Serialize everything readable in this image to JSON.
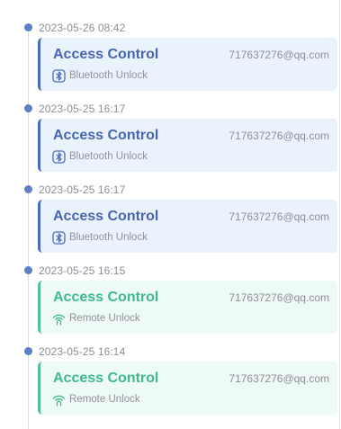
{
  "entries": [
    {
      "time": "2023-05-26 08:42",
      "title": "Access Control",
      "email": "717637276@qq.com",
      "method": "Bluetooth Unlock",
      "kind": "bluetooth",
      "icon": "bluetooth-icon"
    },
    {
      "time": "2023-05-25 16:17",
      "title": "Access Control",
      "email": "717637276@qq.com",
      "method": "Bluetooth Unlock",
      "kind": "bluetooth",
      "icon": "bluetooth-icon"
    },
    {
      "time": "2023-05-25 16:17",
      "title": "Access Control",
      "email": "717637276@qq.com",
      "method": "Bluetooth Unlock",
      "kind": "bluetooth",
      "icon": "bluetooth-icon"
    },
    {
      "time": "2023-05-25 16:15",
      "title": "Access Control",
      "email": "717637276@qq.com",
      "method": "Remote Unlock",
      "kind": "remote",
      "icon": "remote-signal-icon"
    },
    {
      "time": "2023-05-25 16:14",
      "title": "Access Control",
      "email": "717637276@qq.com",
      "method": "Remote Unlock",
      "kind": "remote",
      "icon": "remote-signal-icon"
    }
  ],
  "colors": {
    "bluetooth_accent": "#4a6bbf",
    "bluetooth_bg": "#eaf2fc",
    "remote_accent": "#4ec39a",
    "remote_bg": "#eefaf5",
    "timeline_dot": "#5d7fc4"
  }
}
